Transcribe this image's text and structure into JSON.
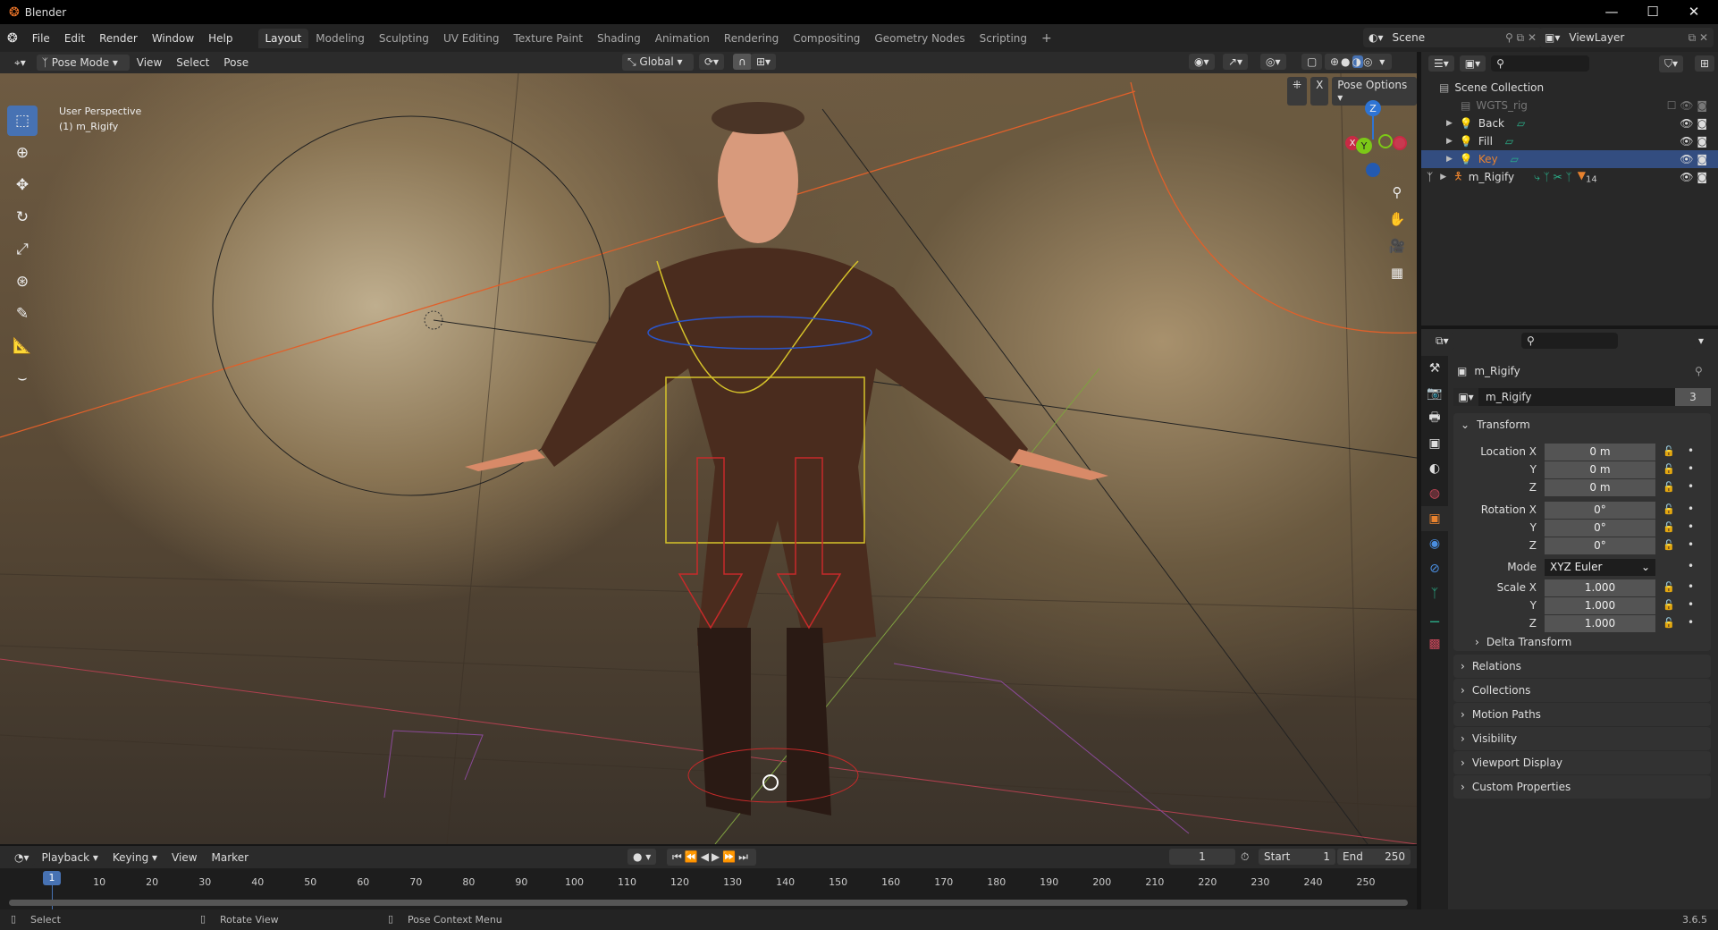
{
  "window": {
    "title": "Blender",
    "minimize": "—",
    "maximize": "☐",
    "close": "✕"
  },
  "menu": {
    "items": [
      "File",
      "Edit",
      "Render",
      "Window",
      "Help"
    ],
    "workspaces": [
      "Layout",
      "Modeling",
      "Sculpting",
      "UV Editing",
      "Texture Paint",
      "Shading",
      "Animation",
      "Rendering",
      "Compositing",
      "Geometry Nodes",
      "Scripting"
    ],
    "add": "+",
    "scene": "Scene",
    "view_layer": "ViewLayer"
  },
  "viewport": {
    "mode": "Pose Mode",
    "menus": [
      "View",
      "Select",
      "Pose"
    ],
    "orientation": "Global",
    "pose_options": "Pose Options",
    "x_label": "X",
    "overlay_title": "User Perspective",
    "overlay_object": "(1) m_Rigify",
    "gizmo": {
      "z": "Z",
      "y": "Y",
      "x": "X"
    }
  },
  "outliner": {
    "scene_collection": "Scene Collection",
    "rows": [
      {
        "name": "WGTS_rig",
        "selected": false
      },
      {
        "name": "Back",
        "selected": false
      },
      {
        "name": "Fill",
        "selected": false
      },
      {
        "name": "Key",
        "selected": true
      },
      {
        "name": "m_Rigify",
        "selected": false,
        "badge": "14"
      }
    ]
  },
  "properties": {
    "object_name": "m_Rigify",
    "data_name": "m_Rigify",
    "users": "3",
    "transform": {
      "title": "Transform",
      "location": {
        "label": "Location X",
        "x": "0 m",
        "y": "0 m",
        "z": "0 m"
      },
      "rotation": {
        "label": "Rotation X",
        "x": "0°",
        "y": "0°",
        "z": "0°"
      },
      "mode_label": "Mode",
      "mode": "XYZ Euler",
      "scale": {
        "label": "Scale X",
        "x": "1.000",
        "y": "1.000",
        "z": "1.000"
      },
      "axis_y": "Y",
      "axis_z": "Z",
      "delta": "Delta Transform"
    },
    "panels": [
      "Relations",
      "Collections",
      "Motion Paths",
      "Visibility",
      "Viewport Display",
      "Custom Properties"
    ]
  },
  "timeline": {
    "menus": [
      "Playback",
      "Keying",
      "View",
      "Marker"
    ],
    "current_frame": "1",
    "start_label": "Start",
    "start": "1",
    "end_label": "End",
    "end": "250",
    "frame_marker": "1",
    "ticks": [
      "10",
      "20",
      "30",
      "40",
      "50",
      "60",
      "70",
      "80",
      "90",
      "100",
      "110",
      "120",
      "130",
      "140",
      "150",
      "160",
      "170",
      "180",
      "190",
      "200",
      "210",
      "220",
      "230",
      "240",
      "250"
    ]
  },
  "status": {
    "select": "Select",
    "rotate": "Rotate View",
    "context": "Pose Context Menu",
    "version": "3.6.5"
  },
  "colors": {
    "accent": "#4772b3",
    "selected_row": "#334d80",
    "key_text": "#e8822e"
  }
}
